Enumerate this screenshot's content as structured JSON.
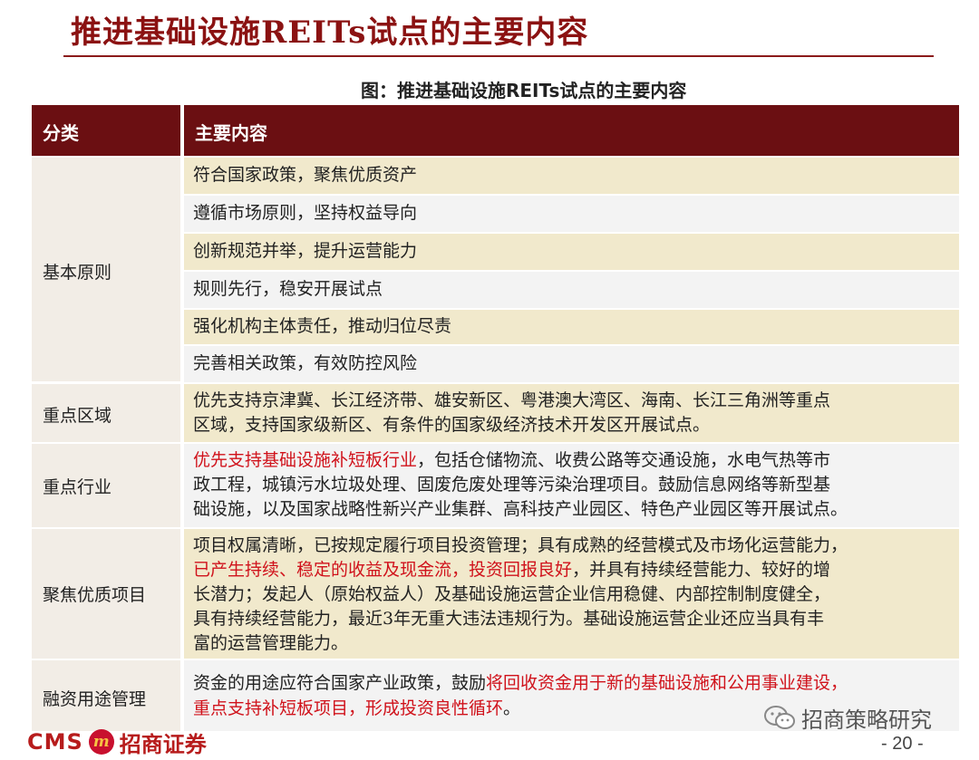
{
  "page": {
    "title": "推进基础设施REITs试点的主要内容",
    "figure_caption": "图：推进基础设施REITs试点的主要内容"
  },
  "table": {
    "headers": {
      "category": "分类",
      "content": "主要内容"
    },
    "principles": {
      "category": "基本原则",
      "items": [
        "符合国家政策，聚焦优质资产",
        "遵循市场原则，坚持权益导向",
        "创新规范并举，提升运营能力",
        "规则先行，稳安开展试点",
        "强化机构主体责任，推动归位尽责",
        "完善相关政策，有效防控风险"
      ]
    },
    "area": {
      "category": "重点区域",
      "lines": [
        "优先支持京津冀、长江经济带、雄安新区、粤港澳大湾区、海南、长江三角洲等重点",
        "区域，支持国家级新区、有条件的国家级经济技术开发区开展试点。"
      ]
    },
    "industry": {
      "category": "重点行业",
      "line1_red": "优先支持基础设施补短板行业",
      "line1_rest": "，包括仓储物流、收费公路等交通设施，水电气热等市",
      "line2": "政工程，城镇污水垃圾处理、固废危废处理等污染治理项目。鼓励信息网络等新型基",
      "line3": "础设施，以及国家战略性新兴产业集群、高科技产业园区、特色产业园区等开展试点。"
    },
    "project": {
      "category": "聚焦优质项目",
      "line1": "项目权属清晰，已按规定履行项目投资管理；具有成熟的经营模式及市场化运营能力，",
      "line2_red": "已产生持续、稳定的收益及现金流，投资回报良好",
      "line2_rest": "，并具有持续经营能力、较好的增",
      "line3": "长潜力；发起人（原始权益人）及基础设施运营企业信用稳健、内部控制制度健全，",
      "line4": "具有持续经营能力，最近3年无重大违法违规行为。基础设施运营企业还应当具有丰",
      "line5": "富的运营管理能力。"
    },
    "usage": {
      "category": "融资用途管理",
      "line1_black": "资金的用途应符合国家产业政策，鼓励",
      "line1_red": "将回收资金用于新的基础设施和公用事业建设，",
      "line2_red": "重点支持补短板项目，形成投资良性循环",
      "line2_black": "。"
    }
  },
  "footer": {
    "logo_cms": "CMS",
    "logo_mark": "m",
    "logo_cn": "招商证券",
    "wechat": "招商策略研究",
    "page_number": "- 20 -"
  }
}
